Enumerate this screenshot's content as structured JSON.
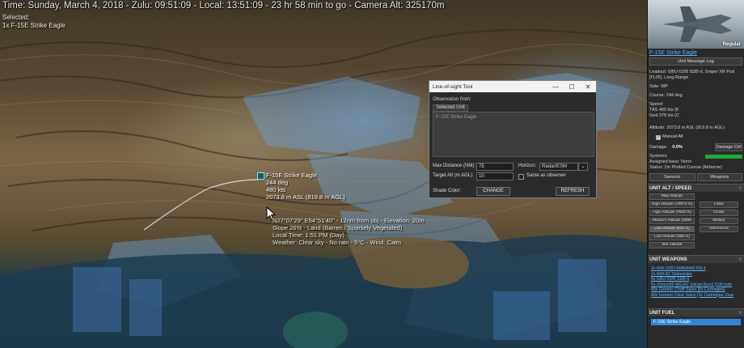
{
  "hud": {
    "status_line": "Time: Sunday, March 4, 2018 - Zulu: 09:51:09 - Local: 13:51:09 - 23 hr 58 min to go -  Camera Alt: 325170m",
    "selected_label": "Selected:",
    "selected_unit": "1x F-15E Strike Eagle"
  },
  "map_unit": {
    "name": "F-15E Strike Eagle",
    "heading": "244 deg",
    "speed": "480 kts",
    "altitude": "2073.8 m ASL (819.8 m AGL)"
  },
  "hover_info": {
    "line1": "N27°07'29\"  E54°51'40\" - 12nm from obj - Elevation: 20m",
    "line2": "Slope 26% - Land (Barren / Sparsely Vegetated)",
    "line3": "Local Time: 1:51 PM (Day)",
    "line4": "Weather: Clear sky - No rain - 5°C - Wind: Calm"
  },
  "los_dialog": {
    "title": "Line-of-sight Tool",
    "minimize": "—",
    "maximize": "☐",
    "close": "✕",
    "observation_label": "Observation from:",
    "tab_selected_unit": "Selected Unit",
    "observer_item": "F-15E Strike Eagle",
    "max_distance_label": "Max Distance (NM):",
    "max_distance_value": "75",
    "horizon_label": "Horizon:",
    "horizon_value": "Radar/ESM",
    "target_alt_label": "Target Alt (m AGL):",
    "target_alt_value": "10",
    "same_as_observer_label": "Same as observer",
    "shade_color_label": "Shade Color:",
    "change_button": "CHANGE",
    "refresh_button": "REFRESH"
  },
  "panel": {
    "rank": "Regular",
    "unit_link": "F-15E Strike Eagle",
    "unit_message_log": "Unit Message Log",
    "loadout": "Loadout: GBU-53/B SDB-II, Sniper XR Pod [FLIR], Long-Range",
    "side": "Side: WP",
    "course": "Course: 244 deg",
    "speed_label": "Speed:",
    "tas": "TAS 480 kts (8",
    "gnd": "Gnd 378 kts (C",
    "altitude": "Altitude: 2073.8 m ASL (819.8 m AGL)",
    "manual_alt": "Manual Alt",
    "damage_label": "Damage:",
    "damage_value": "0.0%",
    "damage_ctrl": "Damage Ctrl",
    "systems_label": "Systems:",
    "assigned_base": "Assigned base: None",
    "status": "Status: On Plotted Course (Airborne)",
    "sensors_button": "Sensors",
    "weapons_button": "Weapons",
    "alt_speed_header": "UNIT ALT / SPEED",
    "max_altitude": "Max Altitude",
    "high_altitude_1": "High Altitude (10973 m)",
    "high_altitude_2": "High Altitude (7620 m)",
    "medium_altitude": "Medium Altitude (3658",
    "low_altitude_1": "Low Altitude (610 m)",
    "low_altitude_2": "Low Altitude (305 m)",
    "min_altitude": "Min Altitude",
    "loiter": "Loiter",
    "cruise": "Cruise",
    "military": "Military",
    "afterburner": "Afterburner",
    "weapons_header": "UNIT WEAPONS",
    "weapons": [
      "2x AIM-120D AMRAAM P3I.4",
      "2x AIM-9X Sidewinder",
      "4x GBU-53/B SDB-II",
      "5x 20mm/85 M61A1 Vulcan Burst [100 rnds",
      "40x Generic Chaff Salvo [6x Cartridges]",
      "40x Generic Flare Salvo [3x Cartridges, Dua"
    ],
    "fuel_header": "UNIT FUEL",
    "fuel_item": "F-15E Strike Eagle",
    "systems_color": "#1fa83a",
    "fuel_color": "#2f86d8"
  }
}
